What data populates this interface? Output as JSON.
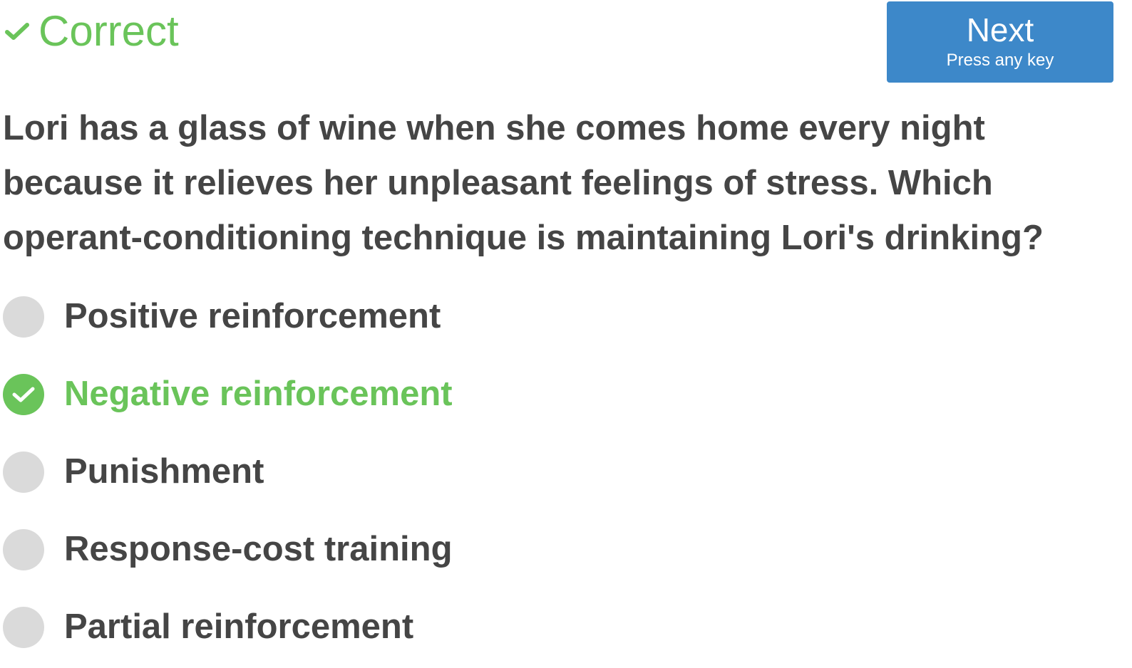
{
  "feedback": {
    "status_text": "Correct",
    "status_icon": "checkmark-icon",
    "status_color": "#6ac45a"
  },
  "next_button": {
    "label": "Next",
    "hint": "Press any key",
    "color": "#3d88c9"
  },
  "question": {
    "text": "Lori has a glass of wine when she comes home every night because it relieves her unpleasant feelings of stress. Which operant-conditioning technique is maintaining Lori's drinking?"
  },
  "options": [
    {
      "label": "Positive reinforcement",
      "state": "unselected"
    },
    {
      "label": "Negative reinforcement",
      "state": "correct"
    },
    {
      "label": "Punishment",
      "state": "unselected"
    },
    {
      "label": "Response-cost training",
      "state": "unselected"
    },
    {
      "label": "Partial reinforcement",
      "state": "unselected"
    }
  ],
  "colors": {
    "text": "#454545",
    "radio_unselected": "#dadada",
    "correct": "#6ac45a"
  }
}
